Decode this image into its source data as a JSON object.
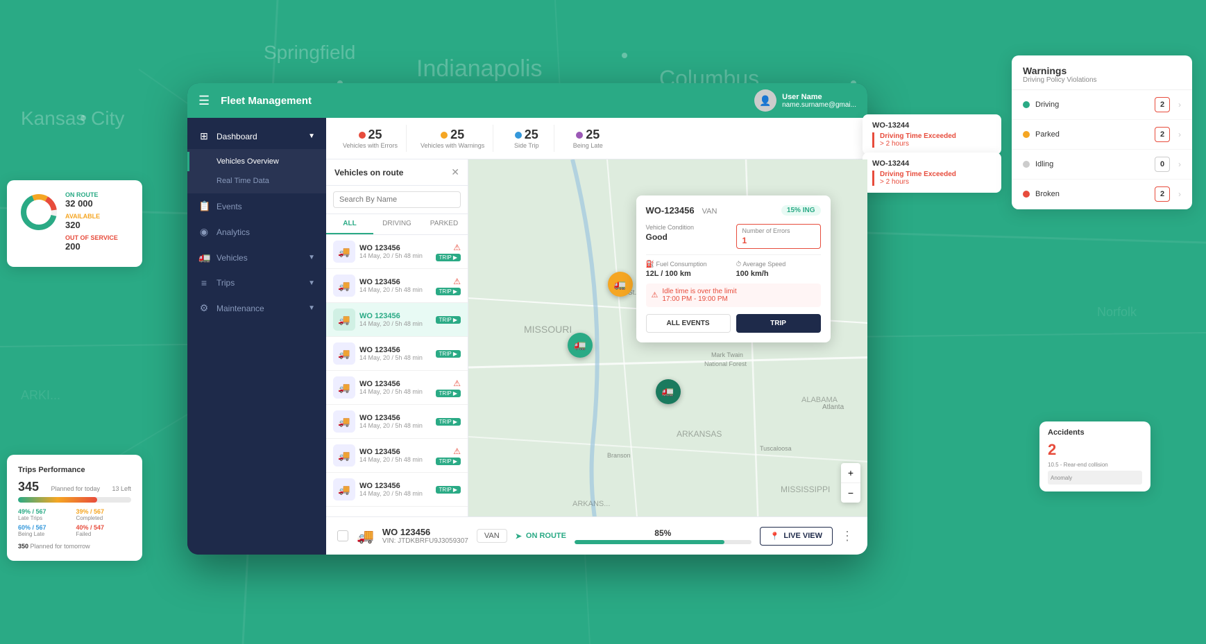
{
  "app": {
    "title": "Fleet Management",
    "bg_cities": [
      "Kansas City",
      "Springfield",
      "Indianapolis",
      "Columbus"
    ]
  },
  "topbar": {
    "title": "Fleet Management",
    "user": {
      "name": "User Name",
      "email": "name.surname@gmai..."
    }
  },
  "sidebar": {
    "items": [
      {
        "label": "Dashboard",
        "icon": "⊞",
        "has_sub": true,
        "active": false
      },
      {
        "label": "Vehicles Overview",
        "active": true,
        "is_sub": true
      },
      {
        "label": "Real Time Data",
        "is_sub": true
      },
      {
        "label": "Events",
        "is_sub": false
      },
      {
        "label": "Analytics",
        "icon": "◉"
      },
      {
        "label": "Vehicles",
        "icon": "🚛",
        "has_arrow": true
      },
      {
        "label": "Trips",
        "icon": "≡",
        "has_arrow": true
      },
      {
        "label": "Maintenance",
        "icon": "⚙",
        "has_arrow": true
      }
    ]
  },
  "stats_bar": {
    "items": [
      {
        "num": "25",
        "label": "Vehicles with Errors",
        "color": "red"
      },
      {
        "num": "25",
        "label": "Vehicles with Warnings",
        "color": "orange"
      },
      {
        "num": "25",
        "label": "Side Trip",
        "color": "blue"
      },
      {
        "num": "25",
        "label": "Being Late",
        "color": "purple"
      }
    ]
  },
  "vehicle_panel": {
    "title": "Vehicles on route",
    "search_placeholder": "Search By Name",
    "tabs": [
      "ALL",
      "DRIVING",
      "PARKED"
    ],
    "active_tab": "ALL",
    "vehicles": [
      {
        "id": "WO 123456",
        "date": "14 May, 20 / 5h 48 min",
        "has_error": true,
        "selected": false
      },
      {
        "id": "WO 123456",
        "date": "14 May, 20 / 5h 48 min",
        "has_error": true,
        "selected": false
      },
      {
        "id": "WO 123456",
        "date": "14 May, 20 / 5h 48 min",
        "has_error": false,
        "selected": true
      },
      {
        "id": "WO 123456",
        "date": "14 May, 20 / 5h 48 min",
        "has_error": false,
        "selected": false
      },
      {
        "id": "WO 123456",
        "date": "14 May, 20 / 5h 48 min",
        "has_error": true,
        "selected": false
      },
      {
        "id": "WO 123456",
        "date": "14 May, 20 / 5h 48 min",
        "has_error": false,
        "selected": false
      },
      {
        "id": "WO 123456",
        "date": "14 May, 20 / 5h 48 min",
        "has_error": true,
        "selected": false
      },
      {
        "id": "WO 123456",
        "date": "14 May, 20 / 5h 48 min",
        "has_error": false,
        "selected": false
      }
    ]
  },
  "vehicle_popup": {
    "id": "WO-123456",
    "type": "VAN",
    "status": "15% ING",
    "condition_label": "Vehicle Condition",
    "condition_value": "Good",
    "errors_label": "Number of Errors",
    "errors_value": "1",
    "fuel_label": "Fuel Consumption",
    "fuel_value": "12L / 100 km",
    "speed_label": "Average Speed",
    "speed_value": "100 km/h",
    "alert": "Idle time is over the limit",
    "alert_time": "17:00 PM - 19:00 PM",
    "btn_all_events": "ALL EVENTS",
    "btn_trip": "TRIP"
  },
  "bottom_bar": {
    "vehicle_id": "WO 123456",
    "vin": "VIN: JTDKBRFU9J3059307",
    "type": "VAN",
    "status": "ON ROUTE",
    "progress": "85%",
    "progress_pct": 85,
    "live_view": "LIVE VIEW"
  },
  "warnings_panel": {
    "title": "Warnings",
    "subtitle": "Driving Policy Violations",
    "items": [
      {
        "label": "Driving",
        "count": "2",
        "color": "green"
      },
      {
        "label": "Parked",
        "count": "2",
        "color": "orange"
      },
      {
        "label": "Idling",
        "count": "0",
        "color": "gray"
      },
      {
        "label": "Broken",
        "count": "2",
        "color": "red"
      }
    ],
    "sub_cards": [
      {
        "wo": "WO-13244",
        "alert": "Driving Time Exceeded",
        "detail": "> 2 hours"
      },
      {
        "wo": "WO-13244",
        "alert": "Driving Time Exceeded",
        "detail": "> 2 hours"
      }
    ]
  },
  "left_stat_card": {
    "on_route_label": "ON ROUTE",
    "on_route_value": "32 000",
    "available_label": "AVAILABLE",
    "available_value": "320",
    "out_of_service_label": "OUT OF SERVICE",
    "out_of_service_value": "200"
  },
  "trips_card": {
    "title": "Trips Performance",
    "planned_today": "345",
    "planned_label": "Planned for today",
    "left_label": "13 Left",
    "bar_pct": 70,
    "stats": [
      {
        "pct": "49% / 567",
        "label": "Late Trips"
      },
      {
        "pct": "39% / 567",
        "label": "Completed"
      },
      {
        "pct": "60% / 567",
        "label": "Being Late"
      },
      {
        "pct": "40% / 547",
        "label": "Failed"
      }
    ],
    "planned_tomorrow": "350",
    "tomorrow_label": "Planned for tomorrow"
  }
}
